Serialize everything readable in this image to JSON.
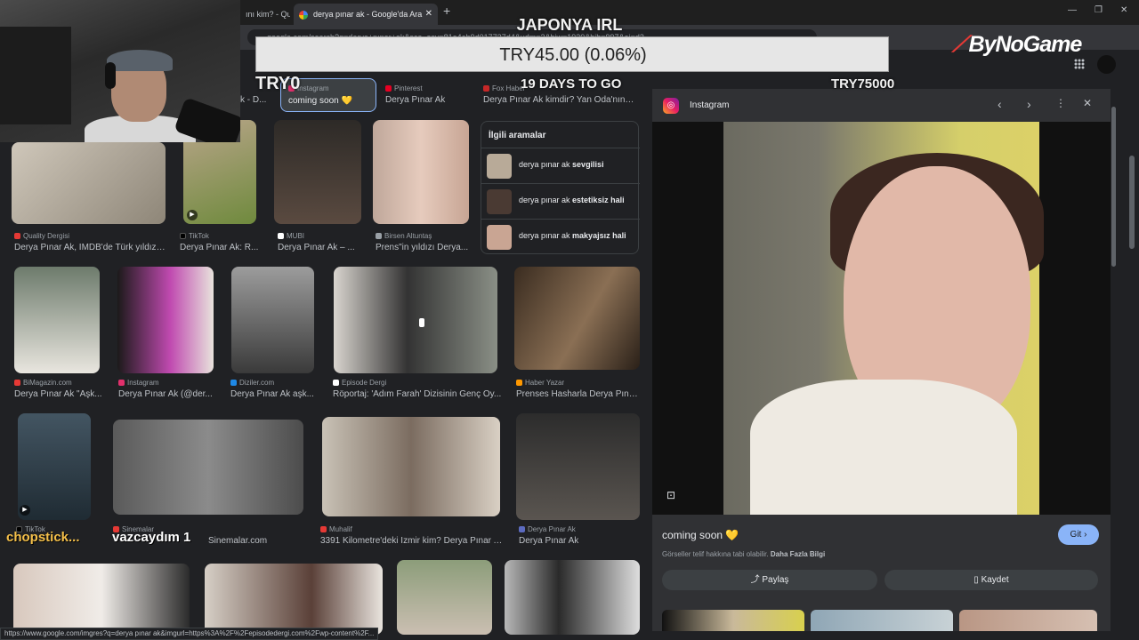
{
  "browser": {
    "tabs": [
      {
        "label": "ını kim? - Qu"
      },
      {
        "label": "derya pınar ak - Google'da Ara",
        "active": true
      }
    ],
    "new_tab": "+",
    "url": "google.com/search?q=derya+pınar+ak&sca_esv=81a4eb9d017737d4&udm=2&biw=1920&bih=997&ei=d3..."
  },
  "overlay": {
    "goal_title": "JAPONYA IRL",
    "goal_bar": "TRY45.00 (0.06%)",
    "goal_min": "TRY0",
    "goal_days": "19 DAYS TO GO",
    "goal_max": "TRY75000",
    "brand": "ByNoGame",
    "chat_user": "chopstick...",
    "chat_message": "vazcaydım 1"
  },
  "top_row": [
    {
      "source": "Instagram",
      "caption": "coming soon 💛"
    },
    {
      "source": "Pinterest",
      "caption": "Derya Pınar Ak"
    },
    {
      "source": "Fox Haber",
      "caption": "Derya Pınar Ak kimdir? Yan Oda'nın Ş..."
    }
  ],
  "top_partial_caption": "k - D...",
  "grid": [
    {
      "source": "Quality Dergisi",
      "caption": "Derya Pınar Ak, IMDB'de Türk yıldızl..."
    },
    {
      "source": "TikTok",
      "caption": "Derya Pınar Ak: R..."
    },
    {
      "source": "MUBI",
      "caption": "Derya Pınar Ak – ..."
    },
    {
      "source": "Birsen Altuntaş",
      "caption": "Prens\"in yıldızı Derya..."
    },
    {
      "source": "BiMagazin.com",
      "caption": "Derya Pınar Ak \"Aşk..."
    },
    {
      "source": "Instagram",
      "caption": "Derya Pınar Ak (@der..."
    },
    {
      "source": "Diziler.com",
      "caption": "Derya Pınar Ak aşk..."
    },
    {
      "source": "Episode Dergi",
      "caption": "Röportaj: 'Adım Farah' Dizisinin Genç Oy..."
    },
    {
      "source": "Haber Yazar",
      "caption": "Prenses Hasharla Derya Pına..."
    },
    {
      "source": "TikTok",
      "caption": ""
    },
    {
      "source": "Sinemalar",
      "caption": "Sinemalar.com"
    },
    {
      "source": "Muhalif",
      "caption": "3391 Kilometre'deki İzmir kim? Derya Pınar A..."
    },
    {
      "source": "Derya Pınar Ak",
      "caption": "Derya Pınar Ak"
    }
  ],
  "related": {
    "title": "İlgili aramalar",
    "items": [
      {
        "prefix": "derya pınar ak ",
        "bold": "sevgilisi"
      },
      {
        "prefix": "derya pınar ak ",
        "bold": "estetiksiz hali"
      },
      {
        "prefix": "derya pınar ak ",
        "bold": "makyajsız hali"
      }
    ]
  },
  "panel": {
    "source": "Instagram",
    "title": "coming soon 💛",
    "visit": "Git ›",
    "copyright": "Görseller telif hakkına tabi olabilir.",
    "learn_more": "Daha Fazla Bilgi",
    "share": "Paylaş",
    "save": "Kaydet"
  },
  "status_url": "https://www.google.com/imgres?q=derya pınar ak&imgurl=https%3A%2F%2Fepisodedergi.com%2Fwp-content%2F...",
  "colors": {
    "accent": "#8ab4f8",
    "bg": "#202124",
    "panel": "#303134"
  }
}
